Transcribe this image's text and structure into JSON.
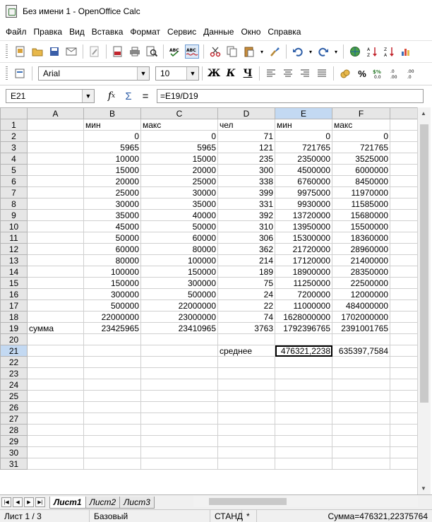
{
  "window": {
    "title": "Без имени 1 - OpenOffice Calc"
  },
  "menu": [
    "Файл",
    "Правка",
    "Вид",
    "Вставка",
    "Формат",
    "Сервис",
    "Данные",
    "Окно",
    "Справка"
  ],
  "format_toolbar": {
    "font_name": "Arial",
    "font_size": "10",
    "bold_label": "Ж",
    "italic_label": "К",
    "underline_label": "Ч"
  },
  "formula_bar": {
    "cell_ref": "E21",
    "formula": "=E19/D19",
    "equals": "="
  },
  "sheet": {
    "columns": [
      "A",
      "B",
      "C",
      "D",
      "E",
      "F"
    ],
    "rows": [
      {
        "n": "1",
        "c": [
          "",
          "мин",
          "макс",
          "чел",
          "мин",
          "макс"
        ]
      },
      {
        "n": "2",
        "c": [
          "",
          "0",
          "0",
          "71",
          "0",
          "0"
        ]
      },
      {
        "n": "3",
        "c": [
          "",
          "5965",
          "5965",
          "121",
          "721765",
          "721765"
        ]
      },
      {
        "n": "4",
        "c": [
          "",
          "10000",
          "15000",
          "235",
          "2350000",
          "3525000"
        ]
      },
      {
        "n": "5",
        "c": [
          "",
          "15000",
          "20000",
          "300",
          "4500000",
          "6000000"
        ]
      },
      {
        "n": "6",
        "c": [
          "",
          "20000",
          "25000",
          "338",
          "6760000",
          "8450000"
        ]
      },
      {
        "n": "7",
        "c": [
          "",
          "25000",
          "30000",
          "399",
          "9975000",
          "11970000"
        ]
      },
      {
        "n": "8",
        "c": [
          "",
          "30000",
          "35000",
          "331",
          "9930000",
          "11585000"
        ]
      },
      {
        "n": "9",
        "c": [
          "",
          "35000",
          "40000",
          "392",
          "13720000",
          "15680000"
        ]
      },
      {
        "n": "10",
        "c": [
          "",
          "45000",
          "50000",
          "310",
          "13950000",
          "15500000"
        ]
      },
      {
        "n": "11",
        "c": [
          "",
          "50000",
          "60000",
          "306",
          "15300000",
          "18360000"
        ]
      },
      {
        "n": "12",
        "c": [
          "",
          "60000",
          "80000",
          "362",
          "21720000",
          "28960000"
        ]
      },
      {
        "n": "13",
        "c": [
          "",
          "80000",
          "100000",
          "214",
          "17120000",
          "21400000"
        ]
      },
      {
        "n": "14",
        "c": [
          "",
          "100000",
          "150000",
          "189",
          "18900000",
          "28350000"
        ]
      },
      {
        "n": "15",
        "c": [
          "",
          "150000",
          "300000",
          "75",
          "11250000",
          "22500000"
        ]
      },
      {
        "n": "16",
        "c": [
          "",
          "300000",
          "500000",
          "24",
          "7200000",
          "12000000"
        ]
      },
      {
        "n": "17",
        "c": [
          "",
          "500000",
          "22000000",
          "22",
          "11000000",
          "484000000"
        ]
      },
      {
        "n": "18",
        "c": [
          "",
          "22000000",
          "23000000",
          "74",
          "1628000000",
          "1702000000"
        ]
      },
      {
        "n": "19",
        "c": [
          "сумма",
          "23425965",
          "23410965",
          "3763",
          "1792396765",
          "2391001765"
        ]
      },
      {
        "n": "20",
        "c": [
          "",
          "",
          "",
          "",
          "",
          ""
        ]
      },
      {
        "n": "21",
        "c": [
          "",
          "",
          "",
          "среднее",
          "476321,2238",
          "635397,7584"
        ]
      },
      {
        "n": "22",
        "c": [
          "",
          "",
          "",
          "",
          "",
          ""
        ]
      },
      {
        "n": "23",
        "c": [
          "",
          "",
          "",
          "",
          "",
          ""
        ]
      },
      {
        "n": "24",
        "c": [
          "",
          "",
          "",
          "",
          "",
          ""
        ]
      },
      {
        "n": "25",
        "c": [
          "",
          "",
          "",
          "",
          "",
          ""
        ]
      },
      {
        "n": "26",
        "c": [
          "",
          "",
          "",
          "",
          "",
          ""
        ]
      },
      {
        "n": "27",
        "c": [
          "",
          "",
          "",
          "",
          "",
          ""
        ]
      },
      {
        "n": "28",
        "c": [
          "",
          "",
          "",
          "",
          "",
          ""
        ]
      },
      {
        "n": "29",
        "c": [
          "",
          "",
          "",
          "",
          "",
          ""
        ]
      },
      {
        "n": "30",
        "c": [
          "",
          "",
          "",
          "",
          "",
          ""
        ]
      },
      {
        "n": "31",
        "c": [
          "",
          "",
          "",
          "",
          "",
          ""
        ]
      }
    ],
    "active_cell": {
      "row": "21",
      "col": "E"
    }
  },
  "sheet_tabs": [
    "Лист1",
    "Лист2",
    "Лист3"
  ],
  "status": {
    "sheet": "Лист 1 / 3",
    "style": "Базовый",
    "mode": "СТАНД",
    "modified": "*",
    "sum": "Сумма=476321,22375764"
  }
}
